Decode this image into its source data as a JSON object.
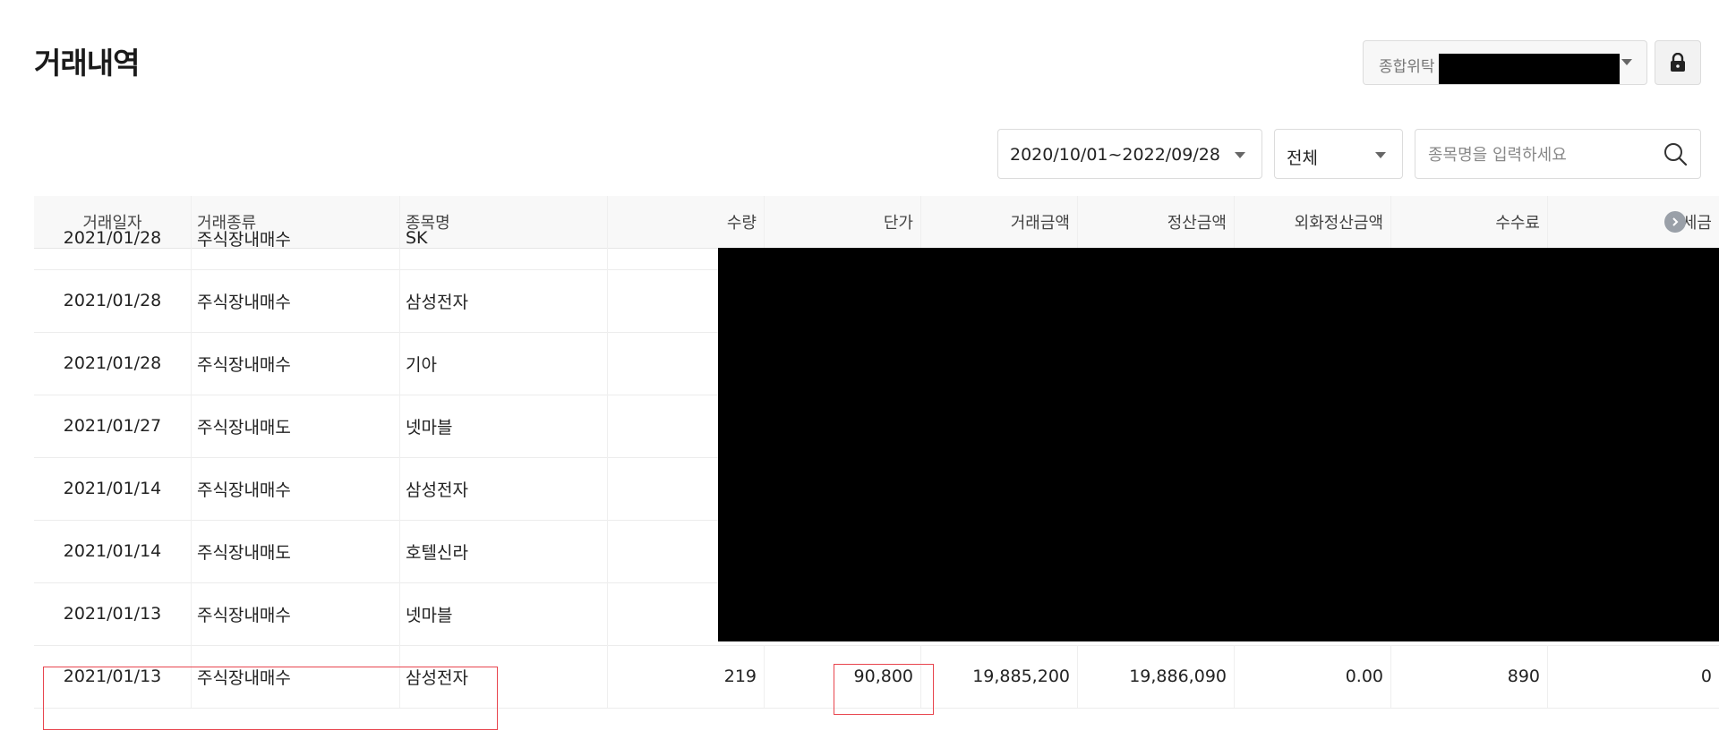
{
  "page": {
    "title": "거래내역"
  },
  "account": {
    "label": "종합위탁"
  },
  "filters": {
    "date_range": "2020/10/01~2022/09/28",
    "type": "전체",
    "search_placeholder": "종목명을 입력하세요"
  },
  "table": {
    "headers": {
      "date": "거래일자",
      "type": "거래종류",
      "name": "종목명",
      "qty": "수량",
      "price": "단가",
      "trade_amount": "거래금액",
      "settle_amount": "정산금액",
      "fx_settle_amount": "외화정산금액",
      "fee": "수수료",
      "tax": "제세금"
    },
    "rows": [
      {
        "date": "2021/01/28",
        "type": "주식장내매수",
        "name": "SK"
      },
      {
        "date": "2021/01/28",
        "type": "주식장내매수",
        "name": "삼성전자"
      },
      {
        "date": "2021/01/28",
        "type": "주식장내매수",
        "name": "기아"
      },
      {
        "date": "2021/01/27",
        "type": "주식장내매도",
        "name": "넷마블"
      },
      {
        "date": "2021/01/14",
        "type": "주식장내매수",
        "name": "삼성전자"
      },
      {
        "date": "2021/01/14",
        "type": "주식장내매도",
        "name": "호텔신라"
      },
      {
        "date": "2021/01/13",
        "type": "주식장내매수",
        "name": "넷마블"
      },
      {
        "date": "2021/01/13",
        "type": "주식장내매수",
        "name": "삼성전자",
        "qty": "219",
        "price": "90,800",
        "trade_amount": "19,885,200",
        "settle_amount": "19,886,090",
        "fx_settle_amount": "0.00",
        "fee": "890",
        "tax": "0"
      }
    ]
  },
  "colors": {
    "highlight": "#e8454e",
    "header_bg": "#f8f8f8",
    "redaction": "#000000"
  },
  "icons": {
    "account_caret": "chevron-down-icon",
    "lock": "lock-icon",
    "search": "search-icon",
    "scroll": "chevron-right-icon"
  }
}
